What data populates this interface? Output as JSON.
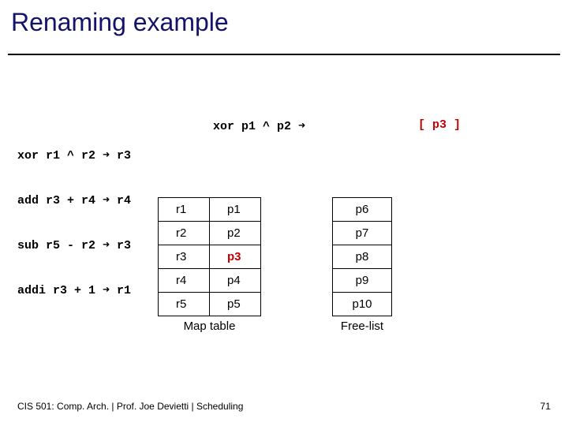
{
  "title": "Renaming example",
  "code": {
    "l1": "xor r1 ^ r2 ➜ r3",
    "l2": "add r3 + r4 ➜ r4",
    "l3": "sub r5 - r2 ➜ r3",
    "l4": "addi r3 + 1 ➜ r1"
  },
  "renamed": {
    "stem": "xor  p1 ^ p2 ➜ ",
    "bracket": "[ p3 ]"
  },
  "map_table": {
    "caption": "Map table",
    "rows": [
      {
        "r": "r1",
        "p": "p1"
      },
      {
        "r": "r2",
        "p": "p2"
      },
      {
        "r": "r3",
        "p": "p3",
        "hot": true
      },
      {
        "r": "r4",
        "p": "p4"
      },
      {
        "r": "r5",
        "p": "p5"
      }
    ]
  },
  "free_list": {
    "caption": "Free-list",
    "items": [
      "p6",
      "p7",
      "p8",
      "p9",
      "p10"
    ]
  },
  "footer": {
    "left": "CIS 501: Comp. Arch.  |  Prof. Joe Devietti  |  Scheduling",
    "right": "71"
  }
}
